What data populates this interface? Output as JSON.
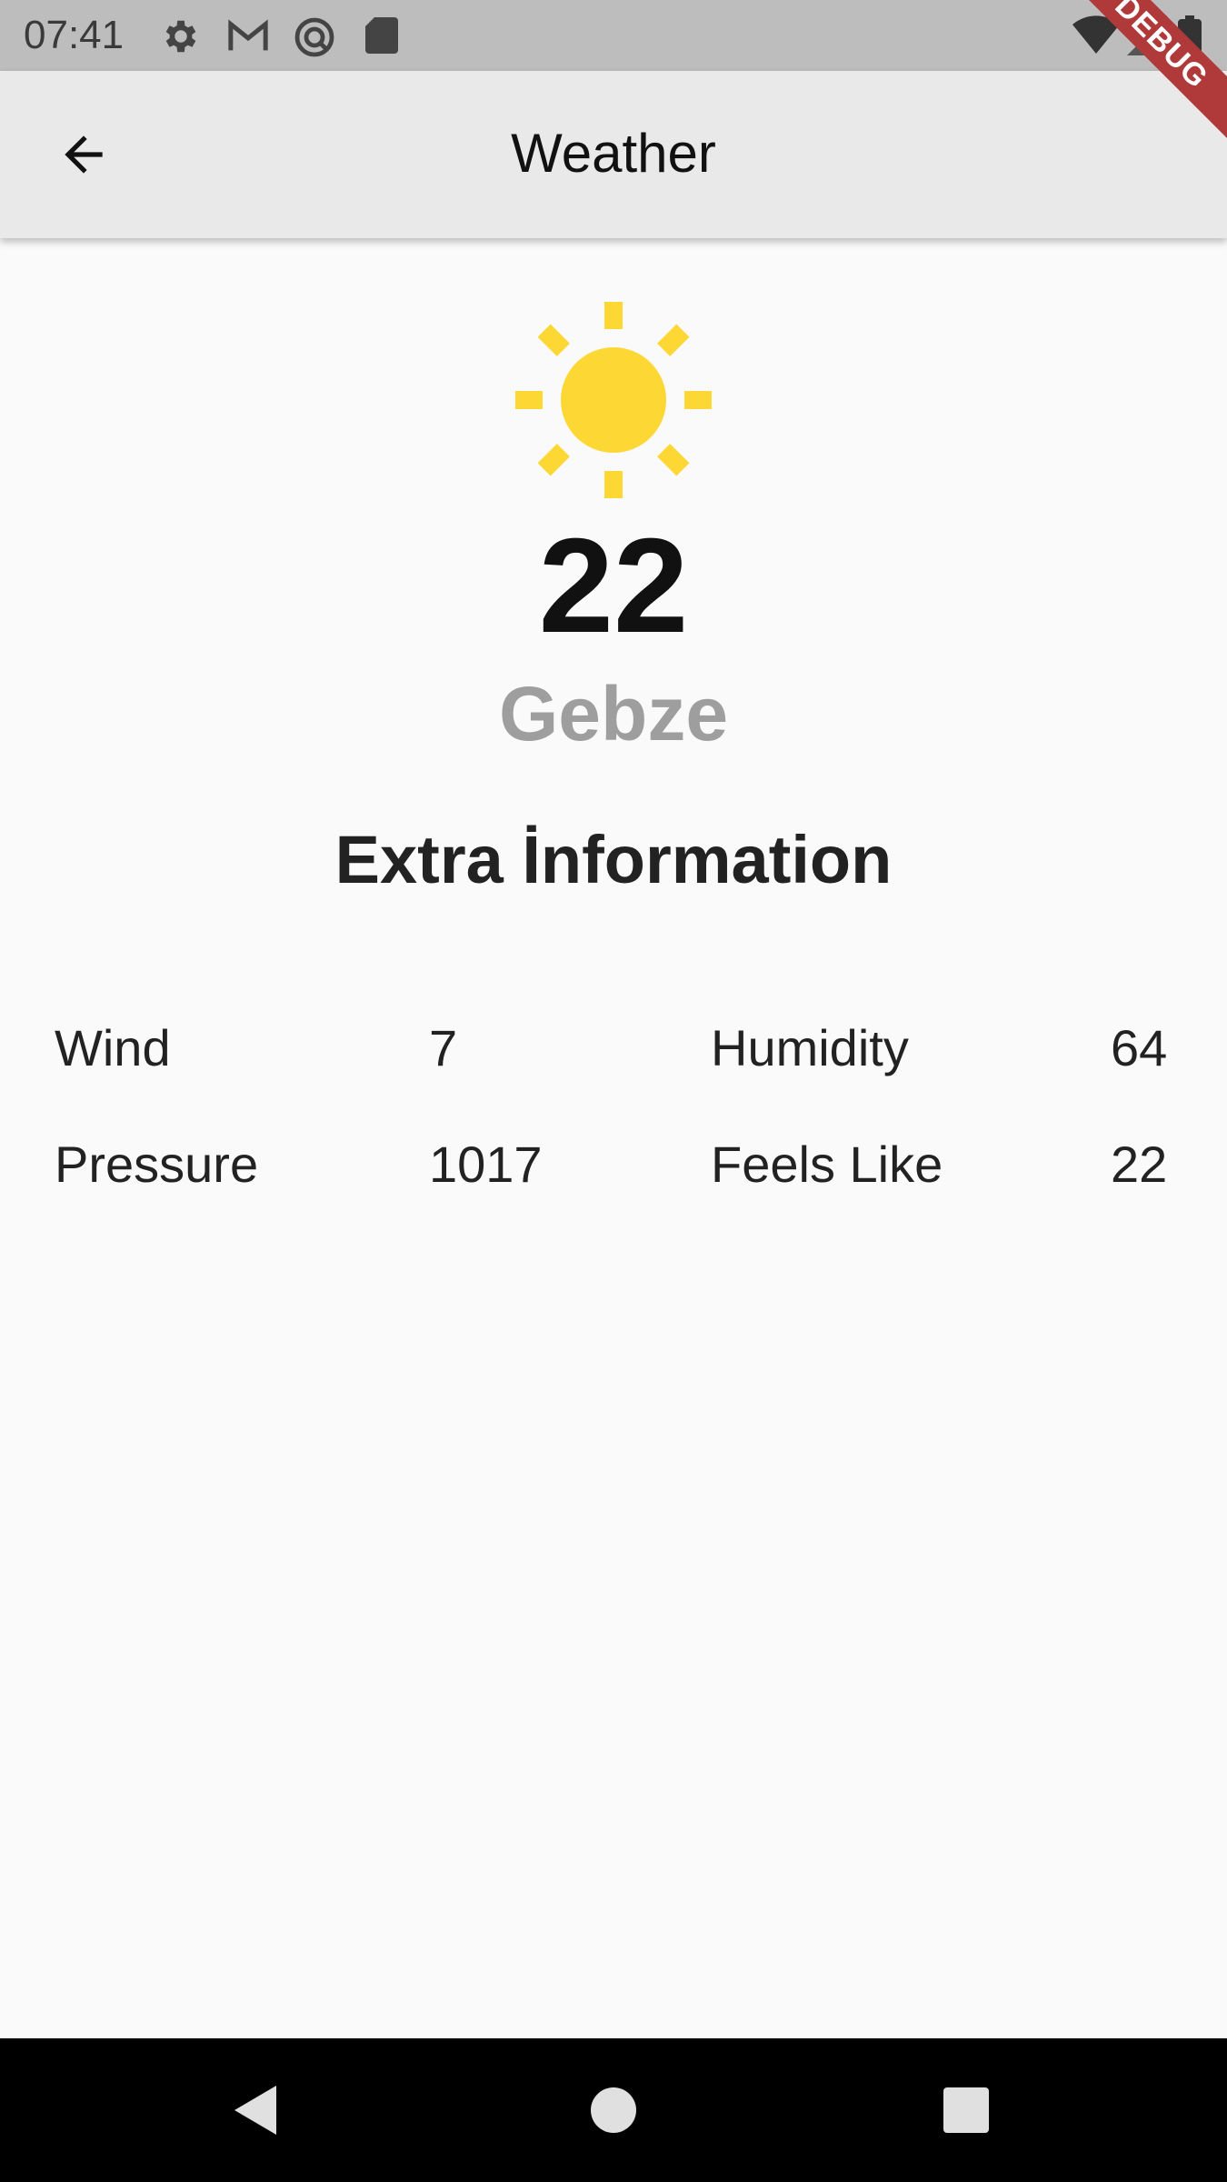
{
  "status_bar": {
    "time": "07:41",
    "icons": [
      "gear-icon",
      "gmail-icon",
      "vpn-icon",
      "sd-card-icon",
      "wifi-icon",
      "signal-icon",
      "battery-icon"
    ]
  },
  "app_bar": {
    "title": "Weather",
    "back_icon": "arrow-back-icon",
    "debug_label": "DEBUG"
  },
  "weather": {
    "icon": "sun-icon",
    "icon_color": "#FDD835",
    "temperature": "22",
    "city": "Gebze"
  },
  "extra": {
    "title": "Extra İnformation",
    "items": [
      {
        "label": "Wind",
        "value": "7"
      },
      {
        "label": "Humidity",
        "value": "64"
      },
      {
        "label": "Pressure",
        "value": "1017"
      },
      {
        "label": "Feels Like",
        "value": "22"
      }
    ]
  },
  "nav_bar": {
    "buttons": [
      "back-triangle-icon",
      "home-circle-icon",
      "recents-square-icon"
    ]
  }
}
